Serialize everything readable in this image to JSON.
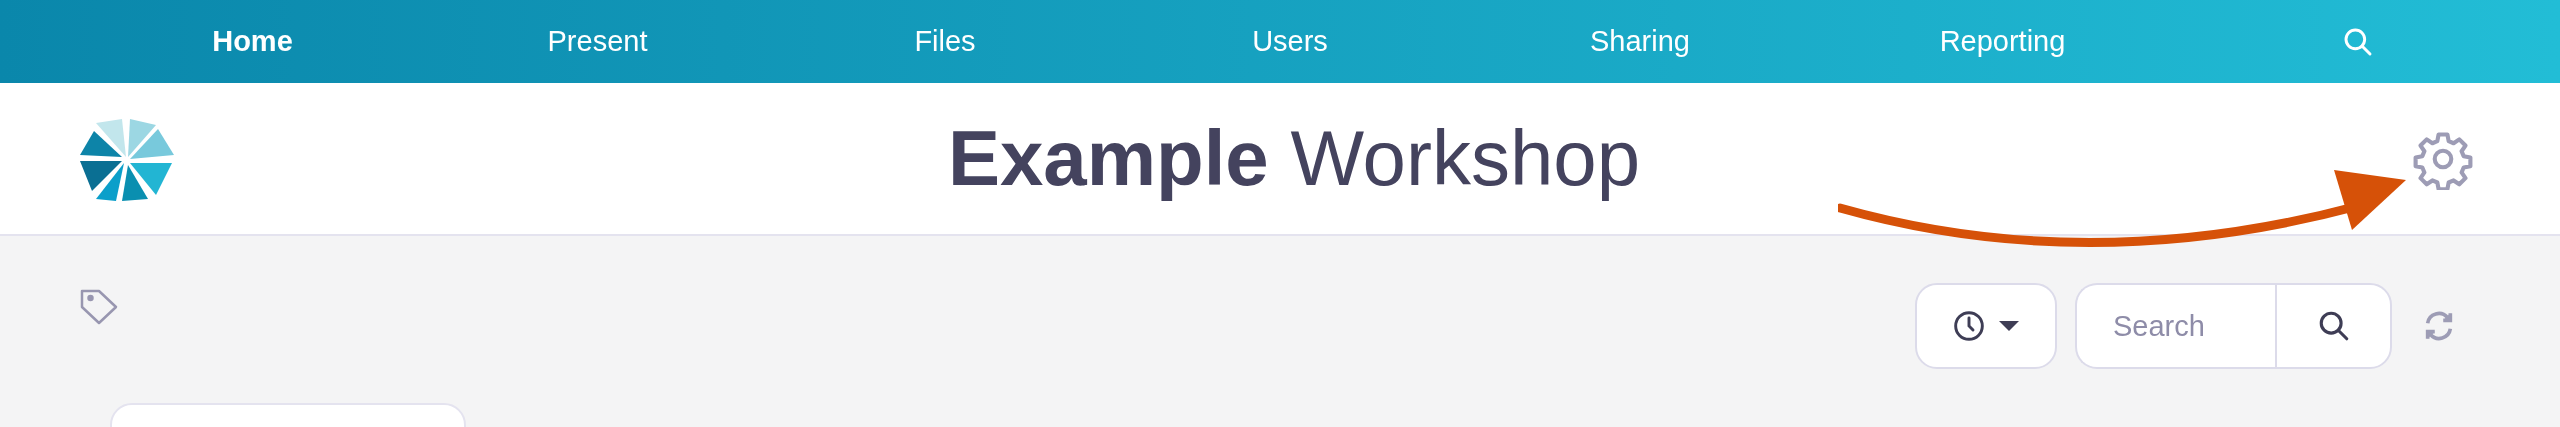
{
  "nav": {
    "items": [
      {
        "label": "Home",
        "selected": true
      },
      {
        "label": "Present",
        "selected": false
      },
      {
        "label": "Files",
        "selected": false
      },
      {
        "label": "Users",
        "selected": false
      },
      {
        "label": "Sharing",
        "selected": false
      },
      {
        "label": "Reporting",
        "selected": false
      }
    ]
  },
  "header": {
    "title": "**Example** Workshop"
  },
  "toolbar": {
    "search": {
      "placeholder": "Search"
    }
  }
}
